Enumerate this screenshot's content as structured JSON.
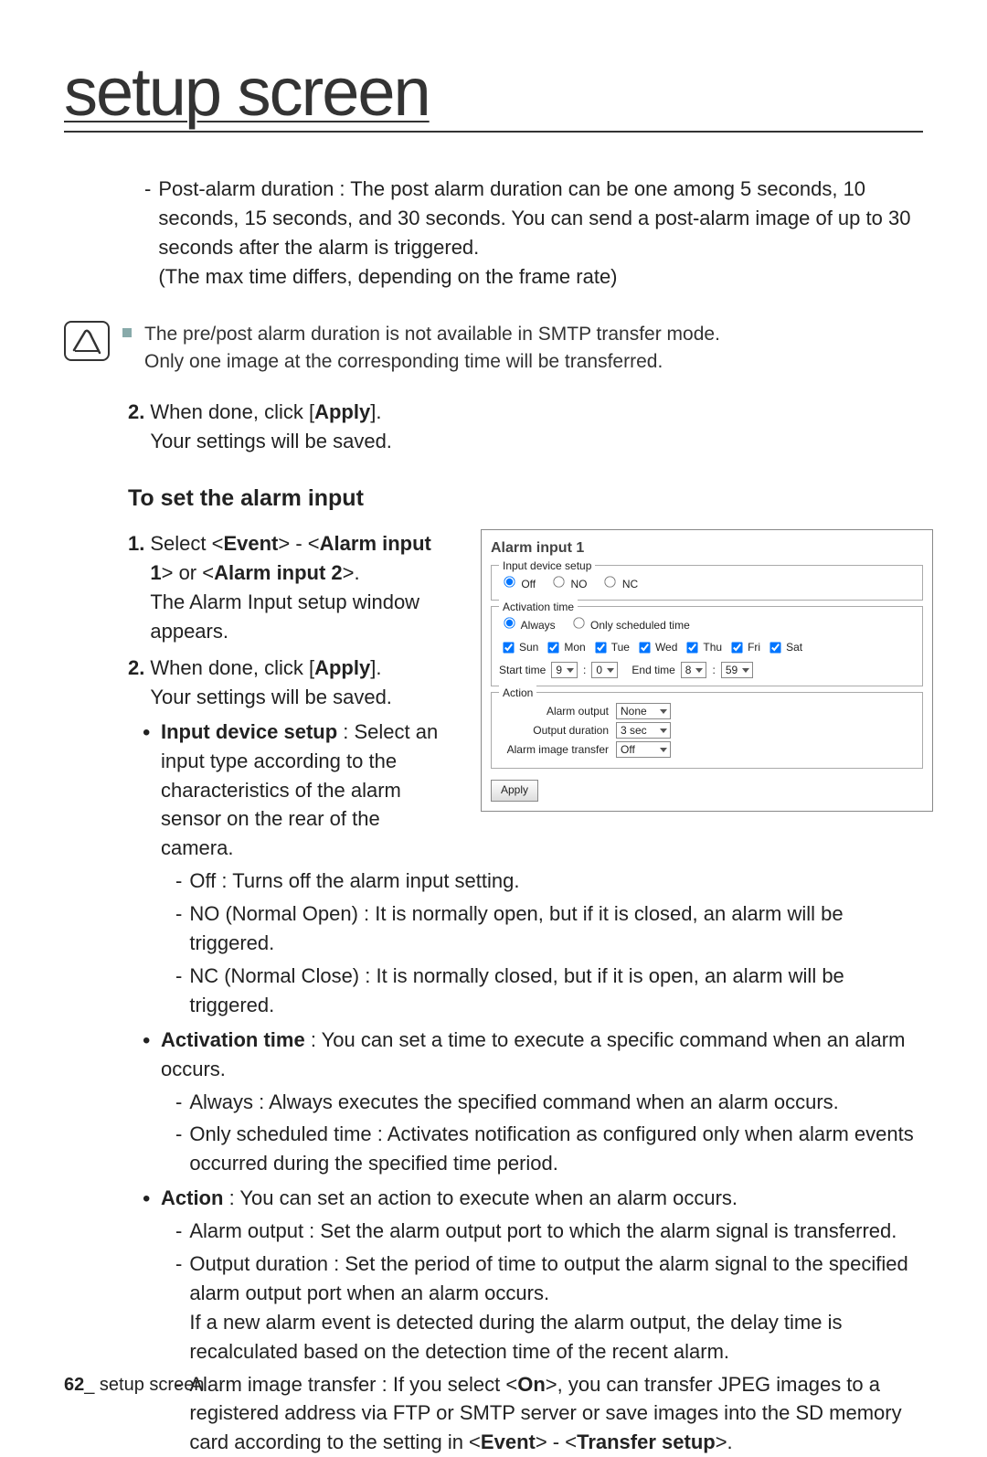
{
  "header": {
    "title": "setup screen"
  },
  "body": {
    "post_alarm": "Post-alarm duration : The post alarm duration can be one among 5 seconds, 10 seconds, 15 seconds, and 30 seconds. You can send a post-alarm image of up to 30 seconds after the alarm is triggered.\n(The max time differs, depending on the frame rate)",
    "note1": "The pre/post alarm duration is not available in SMTP transfer mode.\nOnly one image at the corresponding time will be transferred.",
    "step2_a": "When done, click [",
    "apply_label": "Apply",
    "step2_b": "].\nYour settings will be saved.",
    "h3": "To set the alarm input",
    "step1_text": "Select <",
    "event_label": "Event",
    "step1_sep": "> - <",
    "alarm1_label": "Alarm input 1",
    "step1_or": "> or <",
    "alarm2_label": "Alarm input 2",
    "step1_close": ">.",
    "step1_extra": "The Alarm Input setup window appears.",
    "bullet_ids_head": "Input device setup",
    "bullet_ids_tail": " : Select an input type according to the characteristics of the alarm sensor on the rear of the camera.",
    "dash_off": "Off : Turns off the alarm input setting.",
    "dash_no": "NO (Normal Open) : It is normally open, but if it is closed, an alarm will be triggered.",
    "dash_nc": "NC (Normal Close) : It is normally closed, but if it is open, an alarm will be triggered.",
    "bullet_at_head": "Activation time",
    "bullet_at_tail": " : You can set a time to execute a specific command when an alarm occurs.",
    "dash_always": "Always : Always executes the specified command when an alarm occurs.",
    "dash_sched": "Only scheduled time : Activates notification as configured only when alarm events occurred during the specified time period.",
    "bullet_action_head": "Action",
    "bullet_action_tail": " : You can set an action to execute when an alarm occurs.",
    "dash_alarm_out": "Alarm output : Set the alarm output port to which the alarm signal is transferred.",
    "dash_out_dur": "Output duration : Set the period of time to output the alarm signal to the specified alarm output port when an alarm occurs.\nIf a new alarm event is detected during the alarm output, the delay time is recalculated based on the detection time of the recent alarm.",
    "dash_img_a": "Alarm image transfer : If you select <",
    "on_label": "On",
    "dash_img_b": ">, you can transfer JPEG images to a registered address via FTP or SMTP server or save images into the SD memory card according to the setting in <",
    "transfer_label": "Transfer setup",
    "dash_img_c": ">."
  },
  "panel": {
    "title": "Alarm input 1",
    "legend_ids": "Input device setup",
    "radio_off": "Off",
    "radio_no": "NO",
    "radio_nc": "NC",
    "legend_at": "Activation time",
    "radio_always": "Always",
    "radio_sched": "Only scheduled time",
    "days": [
      "Sun",
      "Mon",
      "Tue",
      "Wed",
      "Thu",
      "Fri",
      "Sat"
    ],
    "start_label": "Start time",
    "end_label": "End time",
    "start_h": "9",
    "start_m": "0",
    "end_h": "8",
    "end_m": "59",
    "legend_action": "Action",
    "lbl_alarm_out": "Alarm output",
    "val_alarm_out": "None",
    "lbl_out_dur": "Output duration",
    "val_out_dur": "3 sec",
    "lbl_img_trans": "Alarm image transfer",
    "val_img_trans": "Off",
    "apply": "Apply"
  },
  "footer": {
    "page": "62",
    "label": "_ setup screen"
  }
}
